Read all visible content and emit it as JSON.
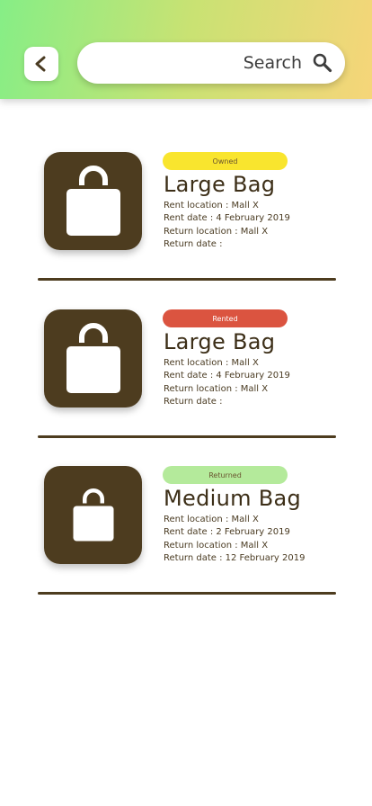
{
  "header": {
    "back_icon": "chevron-left-icon",
    "search": {
      "placeholder": "Search",
      "value": "",
      "icon": "search-icon"
    }
  },
  "colors": {
    "item_bg": "#4d3c1f",
    "owned": "#f9e52e",
    "rented": "#db5440",
    "returned": "#b4ea9b"
  },
  "items": [
    {
      "status": "Owned",
      "title": "Large Bag",
      "icon": "bag-icon",
      "rent_location": "Rent location : Mall X",
      "rent_date": "Rent date : 4 February 2019",
      "return_location": "Return location : Mall X",
      "return_date": "Return date :"
    },
    {
      "status": "Rented",
      "title": "Large Bag",
      "icon": "bag-icon",
      "rent_location": "Rent location : Mall X",
      "rent_date": "Rent date : 4 February 2019",
      "return_location": "Return location : Mall X",
      "return_date": "Return date :"
    },
    {
      "status": "Returned",
      "title": "Medium Bag",
      "icon": "bag-icon",
      "rent_location": "Rent location : Mall X",
      "rent_date": "Rent date : 2 February 2019",
      "return_location": "Return location : Mall X",
      "return_date": "Return date : 12 February 2019"
    }
  ]
}
